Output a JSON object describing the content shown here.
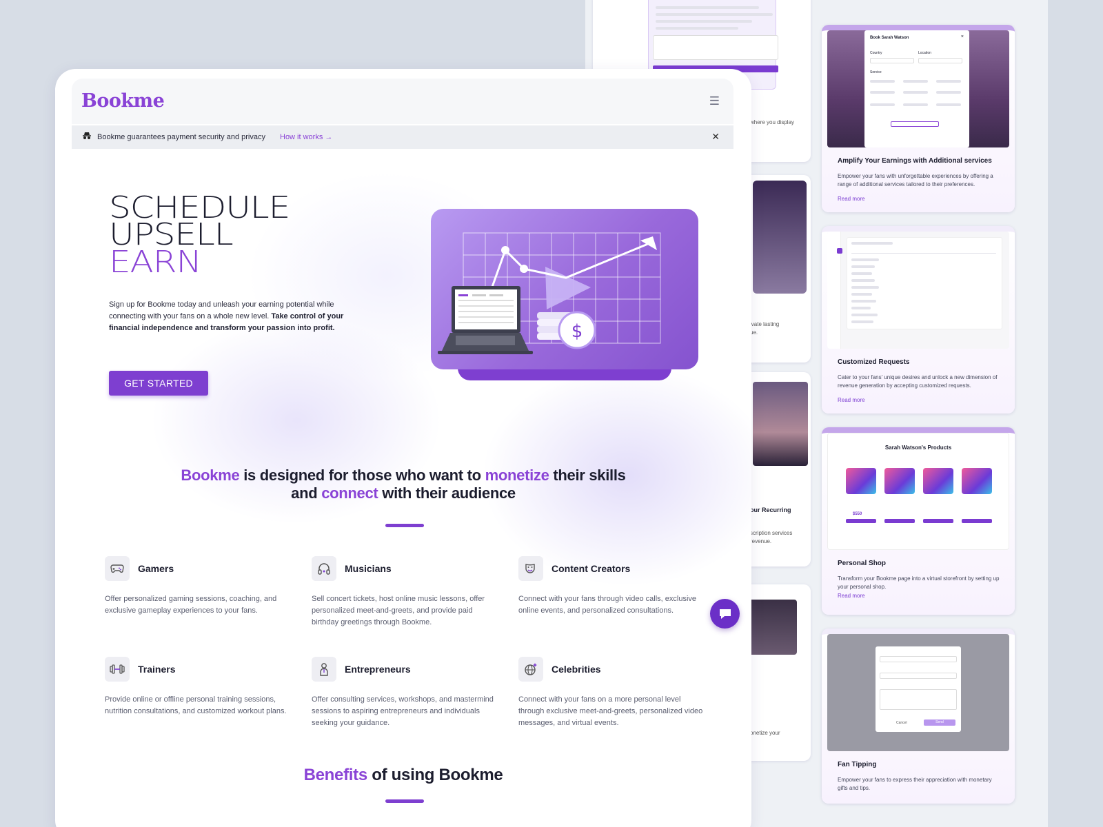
{
  "brand": {
    "name": "Bookme",
    "accent": "#8a43d6",
    "button": "#7e3fd0"
  },
  "notice": {
    "text": "Bookme guarantees payment security and privacy",
    "link": "How it works →"
  },
  "hero": {
    "line1": "SCHEDULE",
    "line2": "UPSELL",
    "line3": "EARN",
    "lead_plain": "Sign up for Bookme today and unleash your earning potential while connecting with your fans on a whole new level. ",
    "lead_bold": "Take control of your financial independence and transform your passion into profit.",
    "cta": "GET STARTED"
  },
  "tagline": {
    "p1": "Bookme",
    "p2": " is designed for those who want to ",
    "p3": "monetize",
    "p4": " their skills",
    "p5": "and ",
    "p6": "connect",
    "p7": " with their audience"
  },
  "features": [
    {
      "title": "Gamers",
      "desc": "Offer personalized gaming sessions, coaching, and exclusive gameplay experiences to your fans.",
      "icon": "gamepad-icon"
    },
    {
      "title": "Musicians",
      "desc": "Sell concert tickets, host online music lessons, offer personalized meet-and-greets, and provide paid birthday greetings through Bookme.",
      "icon": "headphones-icon"
    },
    {
      "title": "Content Creators",
      "desc": "Connect with your fans through video calls, exclusive online events, and personalized consultations.",
      "icon": "masks-icon"
    },
    {
      "title": "Trainers",
      "desc": "Provide online or offline personal training sessions, nutrition consultations, and customized workout plans.",
      "icon": "dumbbell-icon"
    },
    {
      "title": "Entrepreneurs",
      "desc": "Offer consulting services, workshops, and mastermind sessions to aspiring entrepreneurs and individuals seeking your guidance.",
      "icon": "person-icon"
    },
    {
      "title": "Celebrities",
      "desc": "Connect with your fans on a more personal level through exclusive meet-and-greets, personalized video messages, and virtual events.",
      "icon": "globe-sparkle-icon"
    }
  ],
  "benefits": {
    "p1": "Benefits",
    "p2": " of using Bookme"
  },
  "right_cards": [
    {
      "title": "Amplify Your Earnings with Additional services",
      "desc": "Empower your fans with unforgettable experiences by offering a range of additional services tailored to their preferences.",
      "link": "Read more",
      "modal_title": "Book Sarah Watson",
      "country": "Country",
      "location": "Location",
      "service": "Service"
    },
    {
      "title": "Customized Requests",
      "desc": "Cater to your fans' unique desires and unlock a new dimension of revenue generation by accepting customized requests.",
      "link": "Read more"
    },
    {
      "title": "Personal Shop",
      "desc": "Transform your Bookme page into a virtual storefront by setting up your personal shop.",
      "link": "Read more",
      "shop_title": "Sarah Watson's Products",
      "price": "$550"
    },
    {
      "title": "Fan Tipping",
      "desc": "Empower your fans to express their appreciation with monetary gifts and tips.",
      "modal_cancel": "Cancel",
      "modal_send": "Send"
    }
  ],
  "mid_fragments": {
    "a": "where you display",
    "b": "ivate lasting",
    "c": "ue.",
    "d": "our Recurring",
    "e": "scription services",
    "f": "revenue.",
    "g": "onetize your"
  }
}
